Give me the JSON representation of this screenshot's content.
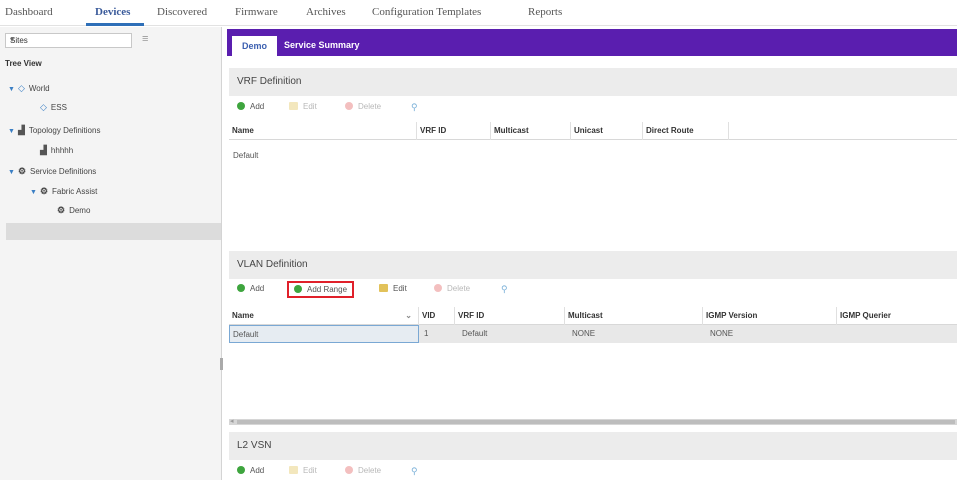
{
  "topnav": {
    "tabs": [
      "Dashboard",
      "Devices",
      "Discovered",
      "Firmware",
      "Archives",
      "Configuration Templates",
      "Reports"
    ],
    "active": "Devices"
  },
  "sidebar": {
    "sites_select": "Sites",
    "tree_title": "Tree View",
    "nodes": [
      "World",
      "ESS",
      "Topology Definitions",
      "hhhhh",
      "Service Definitions",
      "Fabric Assist",
      "Demo"
    ]
  },
  "main": {
    "tabs": [
      "Demo",
      "Service Summary"
    ],
    "vrf": {
      "title": "VRF Definition",
      "toolbar": {
        "add": "Add",
        "edit": "Edit",
        "delete": "Delete"
      },
      "columns": [
        "Name",
        "VRF ID",
        "Multicast",
        "Unicast",
        "Direct Route"
      ],
      "rows": [
        {
          "name": "Default"
        }
      ]
    },
    "vlan": {
      "title": "VLAN Definition",
      "toolbar": {
        "add": "Add",
        "add_range": "Add Range",
        "edit": "Edit",
        "delete": "Delete"
      },
      "columns": [
        "Name",
        "VID",
        "VRF ID",
        "Multicast",
        "IGMP Version",
        "IGMP Querier"
      ],
      "rows": [
        {
          "name": "Default",
          "vid": "1",
          "vrf_id": "Default",
          "multicast": "NONE",
          "igmp_version": "NONE"
        }
      ]
    },
    "l2vsn": {
      "title": "L2 VSN",
      "toolbar": {
        "add": "Add",
        "edit": "Edit",
        "delete": "Delete"
      }
    }
  },
  "colors": {
    "tab_bar": "#5a1eaf",
    "highlight": "#e0202a",
    "accent": "#2e6fb8"
  }
}
